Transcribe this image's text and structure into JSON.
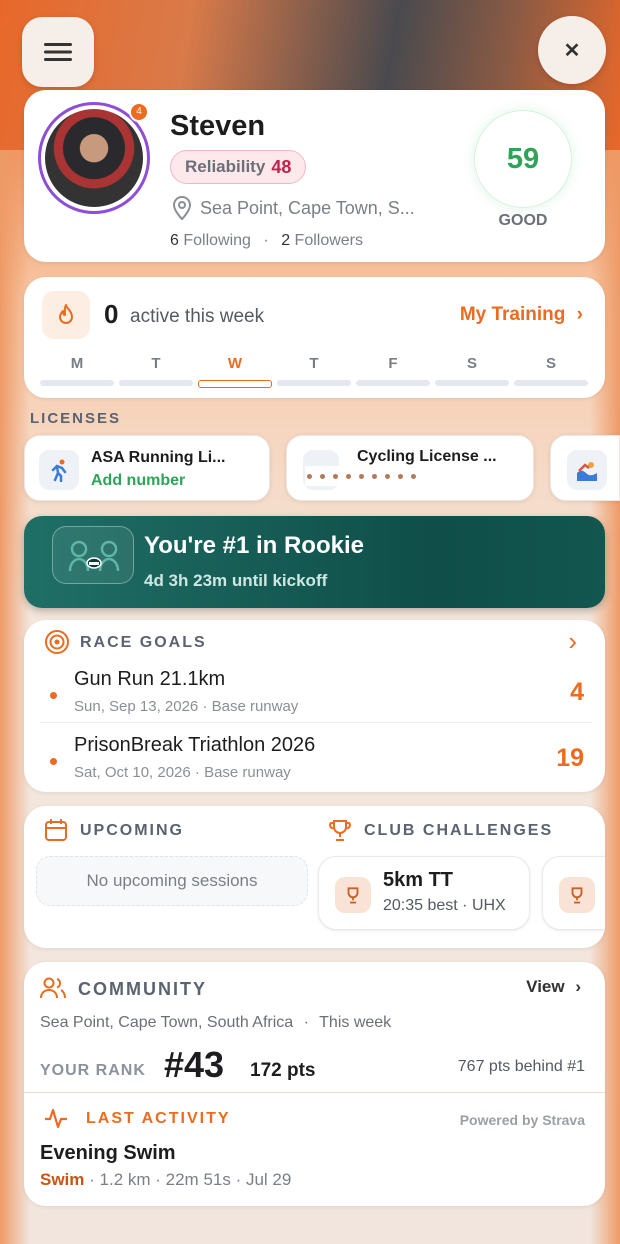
{
  "profile": {
    "name": "Steven",
    "badge_count": "4",
    "reliability_label": "Reliability",
    "reliability_value": "48",
    "location": "Sea Point, Cape Town, S...",
    "following_count": "6",
    "following_label": "Following",
    "followers_count": "2",
    "followers_label": "Followers",
    "score": "59",
    "score_label": "GOOD"
  },
  "week": {
    "active_count": "0",
    "active_label": "active this week",
    "my_training_label": "My Training",
    "days": [
      "M",
      "T",
      "W",
      "T",
      "F",
      "S",
      "S"
    ],
    "current_day_index": 2
  },
  "licenses": {
    "section_title": "LICENSES",
    "items": [
      {
        "title": "ASA Running Li...",
        "subtitle": "Add number",
        "icon": "running-icon"
      },
      {
        "title": "Cycling License ...",
        "subtitle": "",
        "icon": "cycling-icon"
      },
      {
        "title": "",
        "subtitle": "",
        "icon": "swimming-icon"
      }
    ]
  },
  "rookie": {
    "title": "You're #1 in Rookie",
    "subtitle": "4d 3h 23m until kickoff"
  },
  "race_goals": {
    "section_title": "RACE GOALS",
    "items": [
      {
        "name": "Gun Run 21.1km",
        "date": "Sun, Sep 13, 2026 · Base runway",
        "number": "4"
      },
      {
        "name": "PrisonBreak Triathlon 2026",
        "date": "Sat, Oct 10, 2026 · Base runway",
        "number": "19"
      }
    ]
  },
  "upcoming": {
    "section_title": "UPCOMING",
    "empty_text": "No upcoming sessions"
  },
  "club_challenges": {
    "section_title": "CLUB CHALLENGES",
    "items": [
      {
        "title": "5km TT",
        "subtitle": "20:35 best · UHX"
      }
    ]
  },
  "community": {
    "section_title": "COMMUNITY",
    "view_label": "View",
    "location": "Sea Point, Cape Town, South Africa",
    "period": "This week",
    "rank_label": "YOUR RANK",
    "rank": "#43",
    "points": "172 pts",
    "behind": "767 pts behind #1"
  },
  "last_activity": {
    "section_title": "LAST ACTIVITY",
    "powered_by": "Powered by Strava",
    "name": "Evening Swim",
    "type": "Swim",
    "details": "· 1.2 km · 22m 51s · Jul 29"
  },
  "colors": {
    "accent": "#ec6b1f",
    "good": "#2fa357",
    "teal": "#0f4e49",
    "reliability": "#c4204a"
  }
}
